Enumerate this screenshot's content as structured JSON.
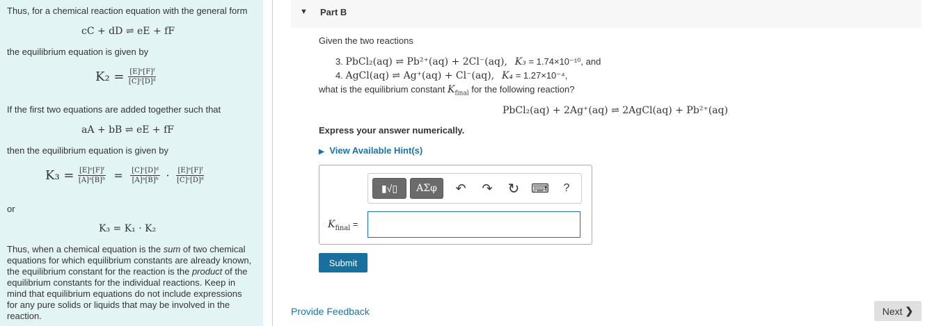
{
  "left": {
    "p1": "Thus, for a chemical reaction equation with the general form",
    "eq1": "cC + dD ⇌ eE + fF",
    "p2": "the equilibrium equation is given by",
    "k2_lhs": "K₂ =",
    "k2_num": "[E]ᵉ[F]ᶠ",
    "k2_den": "[C]ᶜ[D]ᵈ",
    "p3": "If the first two equations are added together such that",
    "eq2": "aA + bB ⇌ eE + fF",
    "p4": "then the equilibrium equation is given by",
    "k3_lhs": "K₃ =",
    "k3_n1": "[E]ᵉ[F]ᶠ",
    "k3_d1": "[A]ᵃ[B]ᵇ",
    "k3_eq": "=",
    "k3_n2": "[C]ᶜ[D]ᵈ",
    "k3_d2": "[A]ᵃ[B]ᵇ",
    "k3_dot": "·",
    "k3_n3": "[E]ᵉ[F]ᶠ",
    "k3_d3": "[C]ᶜ[D]ᵈ",
    "or": "or",
    "eq3": "K₃ = K₁ · K₂",
    "p5_a": "Thus, when a chemical equation is the ",
    "p5_sum": "sum",
    "p5_b": " of two chemical equations for which equilibrium constants are already known, the equilibrium constant for the reaction is the ",
    "p5_product": "product",
    "p5_c": " of the equilibrium constants for the individual reactions. Keep in mind that equilibrium equations do not include expressions for any pure solids or liquids that may be involved in the reaction."
  },
  "part": {
    "title": "Part B",
    "intro": "Given the two reactions",
    "r3_num": "3.",
    "r3_eq": "PbCl₂(aq) ⇌ Pb²⁺(aq) + 2Cl⁻(aq),",
    "r3_k": "K₃",
    "r3_val": " = 1.74×10⁻¹⁰, and",
    "r4_num": "4.",
    "r4_eq": "AgCl(aq) ⇌ Ag⁺(aq) + Cl⁻(aq),",
    "r4_k": "K₄",
    "r4_val": " = 1.27×10⁻⁴,",
    "question_a": "what is the equilibrium constant ",
    "question_k": "K",
    "question_sub": "final",
    "question_b": " for the following reaction?",
    "target": "PbCl₂(aq) + 2Ag⁺(aq) ⇌ 2AgCl(aq) + Pb²⁺(aq)",
    "express": "Express your answer numerically.",
    "hint": "View Available Hint(s)"
  },
  "toolbar": {
    "templates": "▮√▯",
    "greek": "ΑΣφ",
    "undo": "↶",
    "redo": "↷",
    "reset": "↻",
    "keyboard": "⌨",
    "help": "?"
  },
  "answer": {
    "label_k": "K",
    "label_sub": "final",
    "label_eq": " ="
  },
  "submit": "Submit",
  "feedback": "Provide Feedback",
  "next": "Next"
}
